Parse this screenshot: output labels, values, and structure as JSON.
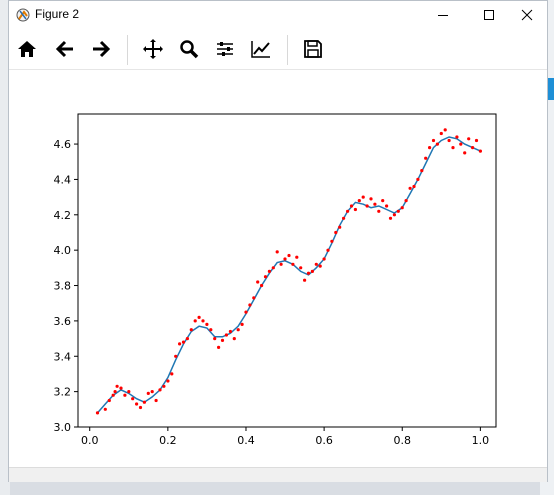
{
  "window": {
    "title": "Figure 2"
  },
  "toolbar": {
    "items": [
      {
        "name": "home-icon"
      },
      {
        "name": "back-arrow-icon"
      },
      {
        "name": "forward-arrow-icon"
      },
      {
        "name": "pan-icon"
      },
      {
        "name": "zoom-icon"
      },
      {
        "name": "configure-subplots-icon"
      },
      {
        "name": "edit-axis-icon"
      },
      {
        "name": "save-icon"
      }
    ]
  },
  "colors": {
    "points": "#ff0000",
    "line": "#1f77b4",
    "axes": "#000000"
  },
  "chart_data": {
    "type": "scatter",
    "title": "",
    "xlabel": "",
    "ylabel": "",
    "xlim": [
      -0.03,
      1.04
    ],
    "ylim": [
      3.0,
      4.77
    ],
    "xticks": [
      "0.0",
      "0.2",
      "0.4",
      "0.6",
      "0.8",
      "1.0"
    ],
    "yticks": [
      "3.0",
      "3.2",
      "3.4",
      "3.6",
      "3.8",
      "4.0",
      "4.2",
      "4.4",
      "4.6"
    ],
    "grid": false,
    "legend": "none",
    "series": [
      {
        "kind": "points",
        "x": [
          0.02,
          0.04,
          0.05,
          0.06,
          0.065,
          0.07,
          0.08,
          0.09,
          0.1,
          0.11,
          0.12,
          0.13,
          0.14,
          0.15,
          0.16,
          0.17,
          0.18,
          0.19,
          0.2,
          0.21,
          0.22,
          0.23,
          0.24,
          0.25,
          0.26,
          0.27,
          0.28,
          0.29,
          0.3,
          0.31,
          0.32,
          0.33,
          0.34,
          0.35,
          0.36,
          0.37,
          0.38,
          0.39,
          0.4,
          0.41,
          0.42,
          0.43,
          0.44,
          0.45,
          0.46,
          0.47,
          0.48,
          0.49,
          0.5,
          0.51,
          0.52,
          0.53,
          0.54,
          0.55,
          0.56,
          0.57,
          0.58,
          0.59,
          0.6,
          0.61,
          0.62,
          0.63,
          0.64,
          0.65,
          0.66,
          0.67,
          0.68,
          0.69,
          0.7,
          0.71,
          0.72,
          0.73,
          0.74,
          0.75,
          0.76,
          0.77,
          0.78,
          0.79,
          0.8,
          0.81,
          0.82,
          0.83,
          0.84,
          0.85,
          0.86,
          0.87,
          0.88,
          0.89,
          0.9,
          0.91,
          0.92,
          0.93,
          0.94,
          0.95,
          0.96,
          0.97,
          0.98,
          0.99,
          1.0
        ],
        "y": [
          3.08,
          3.1,
          3.15,
          3.18,
          3.2,
          3.23,
          3.22,
          3.18,
          3.2,
          3.16,
          3.13,
          3.11,
          3.14,
          3.19,
          3.2,
          3.15,
          3.21,
          3.23,
          3.26,
          3.3,
          3.4,
          3.47,
          3.48,
          3.5,
          3.55,
          3.6,
          3.62,
          3.6,
          3.58,
          3.55,
          3.5,
          3.45,
          3.49,
          3.52,
          3.54,
          3.5,
          3.55,
          3.58,
          3.65,
          3.69,
          3.73,
          3.82,
          3.8,
          3.85,
          3.88,
          3.9,
          3.99,
          3.92,
          3.95,
          3.97,
          3.92,
          3.96,
          3.9,
          3.83,
          3.87,
          3.88,
          3.92,
          3.91,
          3.95,
          4.0,
          4.05,
          4.1,
          4.13,
          4.18,
          4.22,
          4.25,
          4.23,
          4.28,
          4.3,
          4.25,
          4.29,
          4.26,
          4.22,
          4.28,
          4.25,
          4.18,
          4.2,
          4.22,
          4.24,
          4.28,
          4.35,
          4.36,
          4.4,
          4.45,
          4.52,
          4.58,
          4.62,
          4.6,
          4.66,
          4.68,
          4.62,
          4.58,
          4.64,
          4.6,
          4.55,
          4.63,
          4.58,
          4.62,
          4.56
        ]
      },
      {
        "kind": "line",
        "x": [
          0.02,
          0.04,
          0.06,
          0.08,
          0.1,
          0.12,
          0.14,
          0.16,
          0.18,
          0.2,
          0.22,
          0.24,
          0.26,
          0.28,
          0.3,
          0.32,
          0.34,
          0.36,
          0.38,
          0.4,
          0.42,
          0.44,
          0.46,
          0.48,
          0.5,
          0.52,
          0.54,
          0.56,
          0.58,
          0.6,
          0.62,
          0.64,
          0.66,
          0.68,
          0.7,
          0.72,
          0.74,
          0.76,
          0.78,
          0.8,
          0.82,
          0.84,
          0.86,
          0.88,
          0.9,
          0.92,
          0.94,
          0.96,
          0.98,
          1.0
        ],
        "y": [
          3.08,
          3.13,
          3.18,
          3.21,
          3.19,
          3.16,
          3.14,
          3.17,
          3.21,
          3.28,
          3.38,
          3.47,
          3.54,
          3.57,
          3.56,
          3.51,
          3.51,
          3.53,
          3.57,
          3.64,
          3.72,
          3.8,
          3.87,
          3.93,
          3.94,
          3.92,
          3.88,
          3.86,
          3.9,
          3.95,
          4.04,
          4.14,
          4.22,
          4.27,
          4.26,
          4.24,
          4.25,
          4.23,
          4.21,
          4.24,
          4.32,
          4.4,
          4.49,
          4.58,
          4.62,
          4.64,
          4.63,
          4.6,
          4.58,
          4.56
        ]
      }
    ]
  }
}
